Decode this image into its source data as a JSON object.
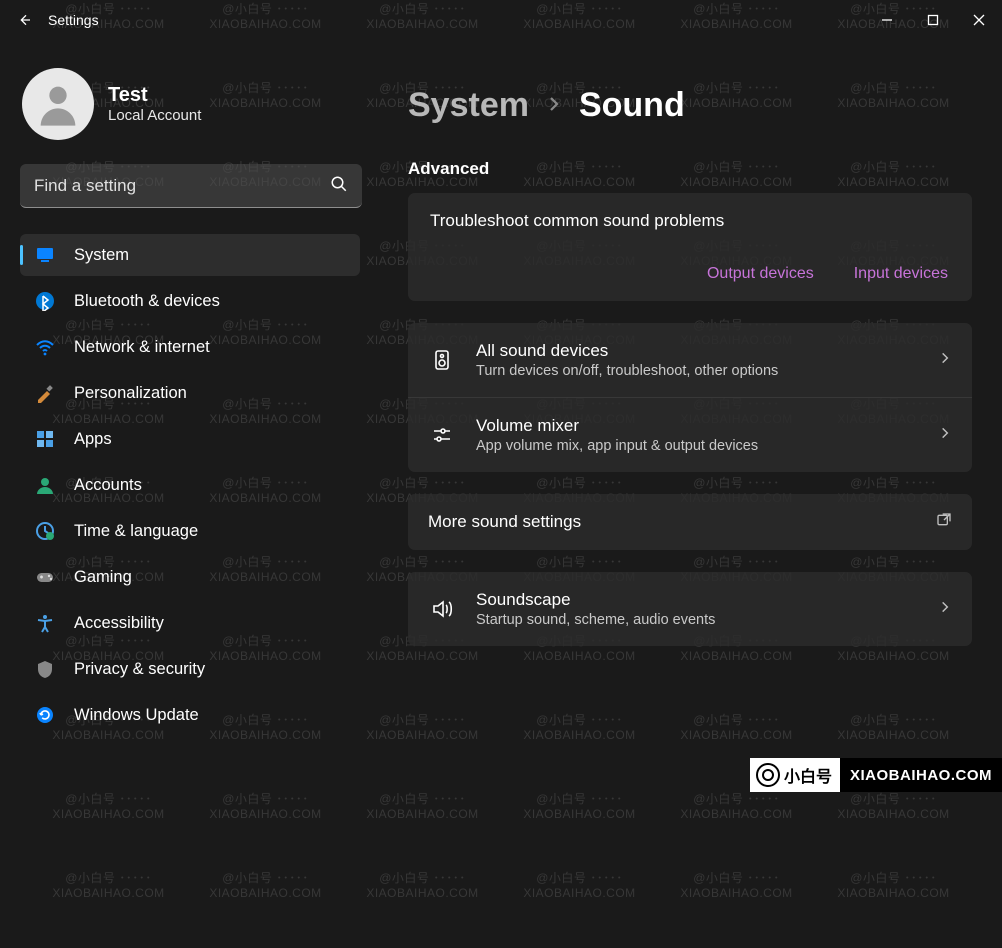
{
  "watermark": {
    "text1": "@小白号",
    "text2": "XIAOBAIHAO.COM",
    "corner_logo": "小白号",
    "corner_domain": "XIAOBAIHAO.COM"
  },
  "titlebar": {
    "title": "Settings"
  },
  "user": {
    "name": "Test",
    "sub": "Local Account"
  },
  "search": {
    "placeholder": "Find a setting"
  },
  "sidebar": {
    "items": [
      {
        "key": "system",
        "label": "System",
        "icon": "monitor",
        "selected": true
      },
      {
        "key": "bluetooth",
        "label": "Bluetooth & devices",
        "icon": "bluetooth"
      },
      {
        "key": "network",
        "label": "Network & internet",
        "icon": "wifi"
      },
      {
        "key": "personalization",
        "label": "Personalization",
        "icon": "brush"
      },
      {
        "key": "apps",
        "label": "Apps",
        "icon": "apps"
      },
      {
        "key": "accounts",
        "label": "Accounts",
        "icon": "person"
      },
      {
        "key": "time",
        "label": "Time & language",
        "icon": "clock"
      },
      {
        "key": "gaming",
        "label": "Gaming",
        "icon": "gamepad"
      },
      {
        "key": "accessibility",
        "label": "Accessibility",
        "icon": "accessibility"
      },
      {
        "key": "privacy",
        "label": "Privacy & security",
        "icon": "shield"
      },
      {
        "key": "update",
        "label": "Windows Update",
        "icon": "refresh"
      }
    ]
  },
  "breadcrumb": {
    "parent": "System",
    "current": "Sound"
  },
  "sections": {
    "advanced": "Advanced",
    "troubleshoot": {
      "title": "Troubleshoot common sound problems",
      "output_link": "Output devices",
      "input_link": "Input devices"
    },
    "rows": [
      {
        "key": "all-sound-devices",
        "icon": "speaker",
        "title": "All sound devices",
        "sub": "Turn devices on/off, troubleshoot, other options",
        "action": "chevron"
      },
      {
        "key": "volume-mixer",
        "icon": "mixer",
        "title": "Volume mixer",
        "sub": "App volume mix, app input & output devices",
        "action": "chevron"
      }
    ],
    "more_sound": {
      "title": "More sound settings",
      "action": "external"
    },
    "soundscape": {
      "title": "Soundscape",
      "sub": "Startup sound, scheme, audio events",
      "action": "chevron"
    }
  }
}
